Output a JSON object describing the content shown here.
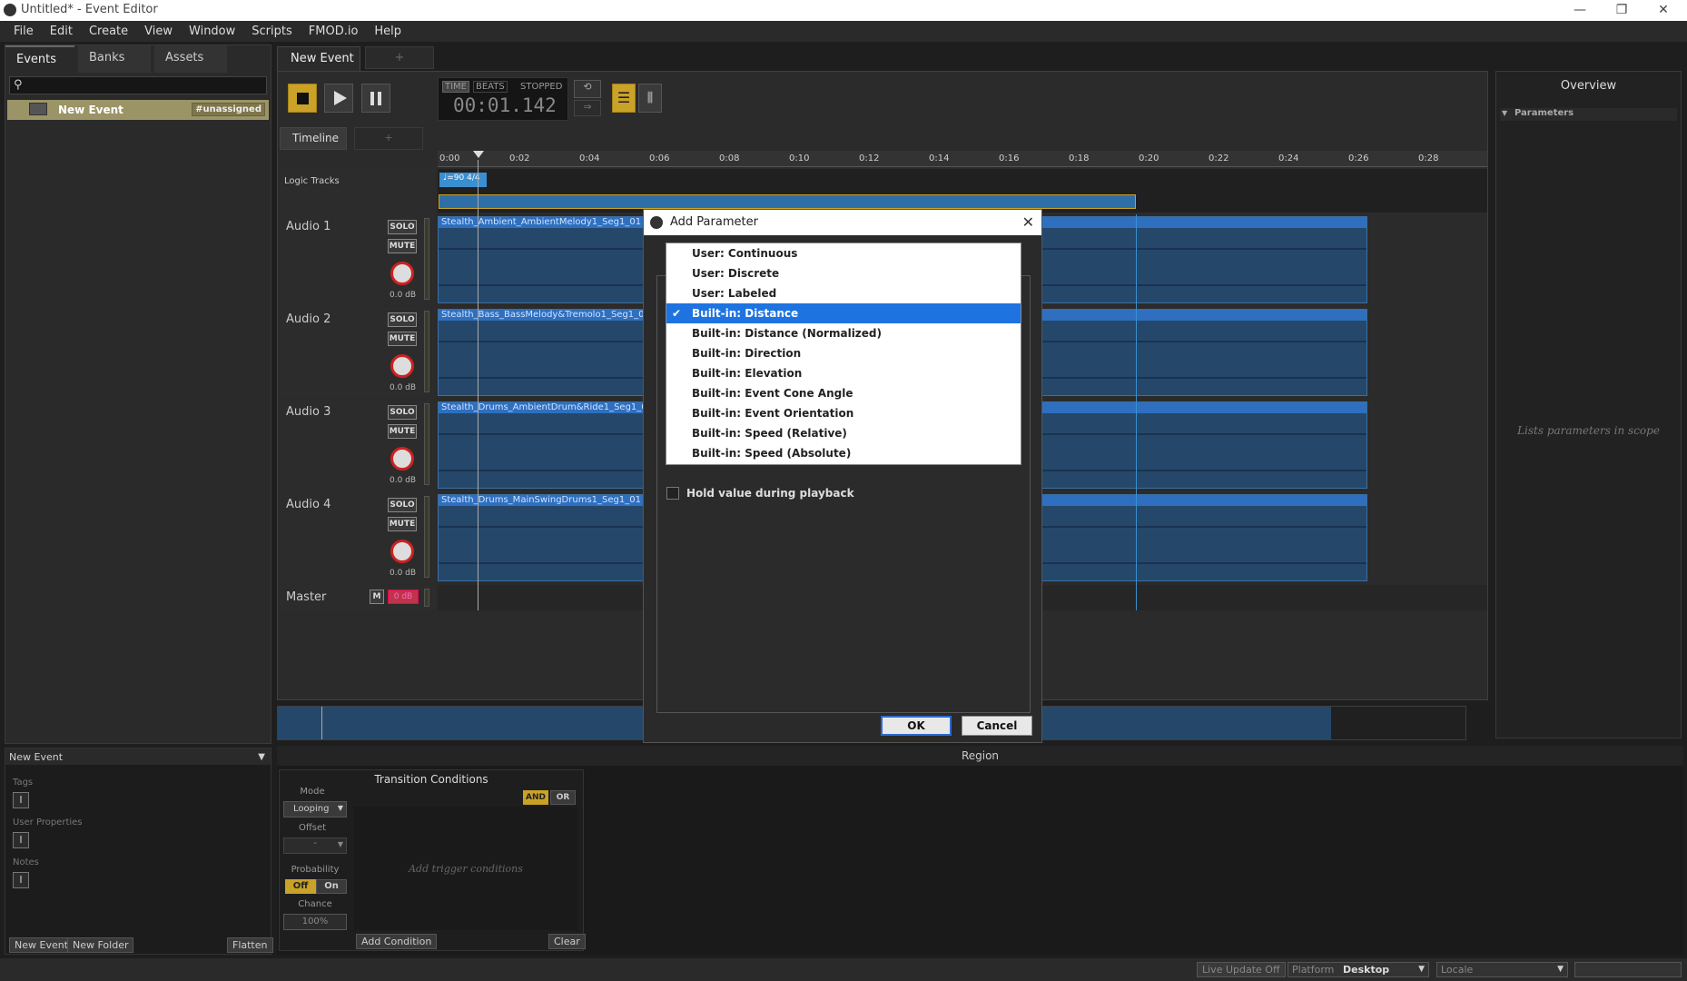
{
  "window": {
    "title": "Untitled* - Event Editor"
  },
  "menu": [
    "File",
    "Edit",
    "Create",
    "View",
    "Window",
    "Scripts",
    "FMOD.io",
    "Help"
  ],
  "left_tabs": [
    "Events",
    "Banks",
    "Assets"
  ],
  "event_item": {
    "name": "New Event",
    "tag": "#unassigned"
  },
  "props": {
    "header": "New Event",
    "tags_label": "Tags",
    "user_props_label": "User Properties",
    "notes_label": "Notes",
    "cursor_glyph": "I",
    "new_event_btn": "New Event",
    "new_folder_btn": "New Folder",
    "flatten_btn": "Flatten"
  },
  "editor": {
    "tab": "New Event",
    "add_tab": "+",
    "time_label": "TIME",
    "beats_label": "BEATS",
    "state": "STOPPED",
    "time": "00:01.142",
    "timeline_tab": "Timeline",
    "ruler": [
      "0:00",
      "0:02",
      "0:04",
      "0:06",
      "0:08",
      "0:10",
      "0:12",
      "0:14",
      "0:16",
      "0:18",
      "0:20",
      "0:22",
      "0:24",
      "0:26",
      "0:28"
    ],
    "logic_tracks_label": "Logic Tracks",
    "tempo_marker": "♩=90 4/4",
    "tracks": [
      {
        "name": "Audio 1",
        "clip": "Stealth_Ambient_AmbientMelody1_Seg1_01",
        "db": "0.0 dB"
      },
      {
        "name": "Audio 2",
        "clip": "Stealth_Bass_BassMelody&Tremolo1_Seg1_01",
        "db": "0.0 dB"
      },
      {
        "name": "Audio 3",
        "clip": "Stealth_Drums_AmbientDrum&Ride1_Seg1_01",
        "db": "0.0 dB"
      },
      {
        "name": "Audio 4",
        "clip": "Stealth_Drums_MainSwingDrums1_Seg1_01",
        "db": "0.0 dB"
      }
    ],
    "solo": "SOLO",
    "mute": "MUTE",
    "master_label": "Master",
    "master_m": "M",
    "master_db": "0 dB"
  },
  "overview": {
    "title": "Overview",
    "parameters_label": "Parameters",
    "placeholder": "Lists parameters in scope"
  },
  "region": {
    "title": "Region",
    "transition_title": "Transition Conditions",
    "and": "AND",
    "or": "OR",
    "mode_label": "Mode",
    "mode_value": "Looping",
    "offset_label": "Offset",
    "offset_value": "-",
    "probability_label": "Probability",
    "off": "Off",
    "on": "On",
    "chance_label": "Chance",
    "chance_value": "100%",
    "add_trigger": "Add trigger conditions",
    "add_condition": "Add Condition",
    "clear": "Clear"
  },
  "status": {
    "live_update": "Live Update Off",
    "platform_label": "Platform",
    "platform_value": "Desktop",
    "locale_label": "Locale"
  },
  "dialog": {
    "title": "Add Parameter",
    "options": [
      "User: Continuous",
      "User: Discrete",
      "User: Labeled",
      "Built-in: Distance",
      "Built-in: Distance (Normalized)",
      "Built-in: Direction",
      "Built-in: Elevation",
      "Built-in: Event Cone Angle",
      "Built-in: Event Orientation",
      "Built-in: Speed (Relative)",
      "Built-in: Speed (Absolute)"
    ],
    "selected_index": 3,
    "check_glyph": "✔",
    "hold_label": "Hold value during playback",
    "ok": "OK",
    "cancel": "Cancel",
    "close": "✕"
  }
}
